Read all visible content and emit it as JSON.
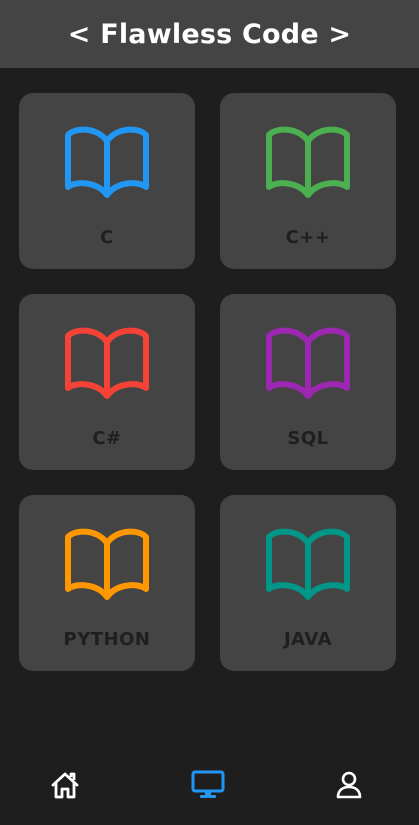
{
  "header": {
    "title": "< Flawless Code >"
  },
  "courses": [
    {
      "label": "C",
      "color": "#2196f3",
      "icon": "book-open-icon"
    },
    {
      "label": "C++",
      "color": "#4caf50",
      "icon": "book-open-icon"
    },
    {
      "label": "C#",
      "color": "#f44336",
      "icon": "book-open-icon"
    },
    {
      "label": "SQL",
      "color": "#9c27b0",
      "icon": "book-open-icon"
    },
    {
      "label": "PYTHON",
      "color": "#ff9800",
      "icon": "book-open-icon"
    },
    {
      "label": "JAVA",
      "color": "#009688",
      "icon": "book-open-icon"
    }
  ],
  "bottom_nav": {
    "items": [
      {
        "icon": "home-icon",
        "color": "#ffffff",
        "active": false
      },
      {
        "icon": "desktop-icon",
        "color": "#2196f3",
        "active": true
      },
      {
        "icon": "profile-icon",
        "color": "#ffffff",
        "active": false
      }
    ]
  }
}
